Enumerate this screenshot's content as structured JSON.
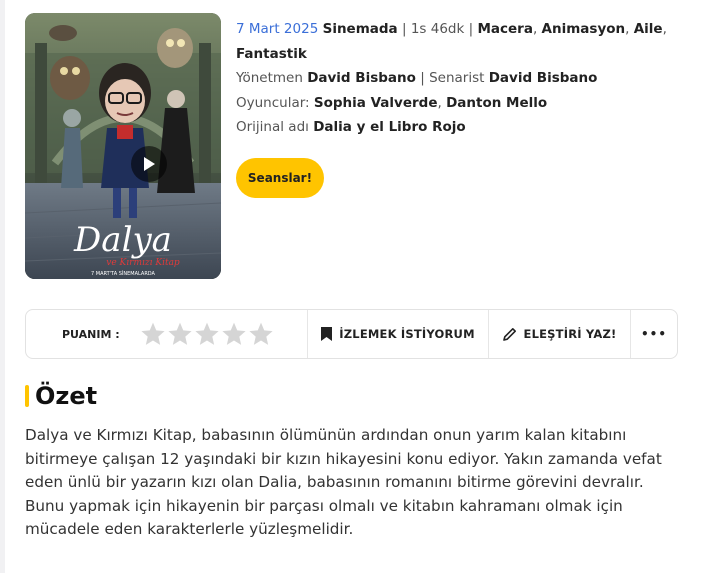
{
  "poster": {
    "title_art": "Dalya",
    "subtitle_art": "ve Kırmızı Kitap",
    "release_art": "7 MART'TA SİNEMALARDA"
  },
  "info": {
    "date": "7 Mart 2025",
    "status": "Sinemada",
    "sep1": "|",
    "duration": "1s 46dk",
    "sep2": "|",
    "genres": [
      "Macera",
      "Animasyon",
      "Aile",
      "Fantastik"
    ],
    "director_label": "Yönetmen",
    "director": "David Bisbano",
    "sep3": "|",
    "writer_label": "Senarist",
    "writer": "David Bisbano",
    "cast_label": "Oyuncular:",
    "cast": [
      "Sophia Valverde",
      "Danton Mello"
    ],
    "original_label": "Orijinal adı",
    "original_title": "Dalia y el Libro Rojo"
  },
  "sessions_button": "Seanslar!",
  "actions": {
    "rating_label": "PUANIM :",
    "rating_value": 0,
    "rating_max": 5,
    "watchlist_label": "İZLEMEK İSTİYORUM",
    "review_label": "ELEŞTİRİ YAZ!",
    "more_label": "•••"
  },
  "summary": {
    "heading": "Özet",
    "text": "Dalya ve Kırmızı Kitap, babasının ölümünün ardından onun yarım kalan kitabını bitirmeye çalışan 12 yaşındaki bir kızın hikayesini konu ediyor. Yakın zamanda vefat eden ünlü bir yazarın kızı olan Dalia, babasının romanını bitirme görevini devralır. Bunu yapmak için hikayenin bir parçası olmalı ve kitabın kahramanı olmak için mücadele eden karakterlerle yüzleşmelidir."
  },
  "colors": {
    "accent": "#ffc400",
    "date": "#3b6fd8",
    "star_empty": "#d5d5d5"
  }
}
